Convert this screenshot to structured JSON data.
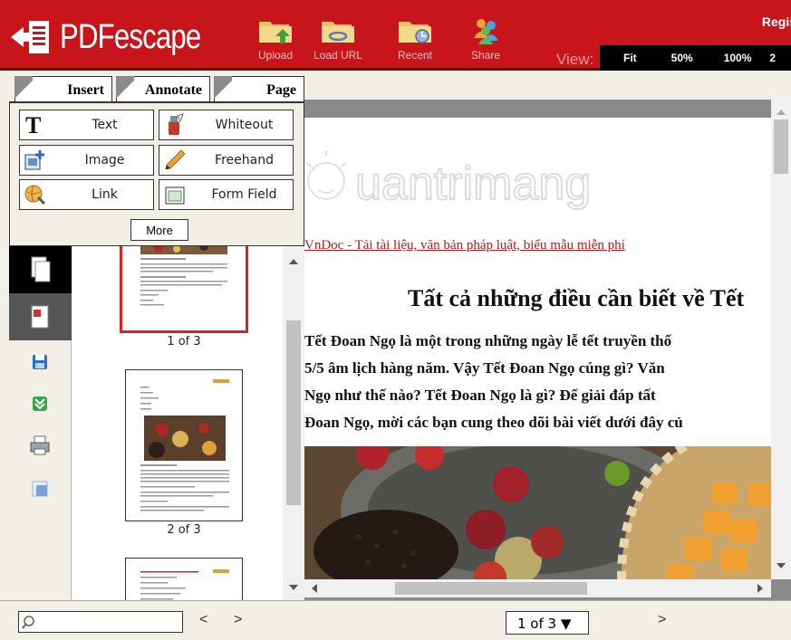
{
  "header": {
    "logo_text": "PDFescape",
    "register": "Regis",
    "view_label": "View:",
    "buttons": [
      {
        "label": "Upload",
        "icon": "folder-upload-icon"
      },
      {
        "label": "Load URL",
        "icon": "folder-link-icon"
      },
      {
        "label": "Recent",
        "icon": "folder-clock-icon"
      },
      {
        "label": "Share",
        "icon": "people-share-icon"
      }
    ],
    "view_options": [
      "Fit",
      "50%",
      "100%",
      "2"
    ]
  },
  "tabs": [
    "Insert",
    "Annotate",
    "Page"
  ],
  "tools": [
    {
      "label": "Text",
      "icon": "text-tool-icon"
    },
    {
      "label": "Whiteout",
      "icon": "whiteout-bottle-icon"
    },
    {
      "label": "Image",
      "icon": "insert-image-icon"
    },
    {
      "label": "Freehand",
      "icon": "pencil-icon"
    },
    {
      "label": "Link",
      "icon": "link-globe-icon"
    },
    {
      "label": "Form Field",
      "icon": "form-field-icon"
    }
  ],
  "more_label": "More",
  "sidebar_icons": [
    "pages-icon",
    "pdf-icon",
    "save-icon",
    "download-icon",
    "print-icon",
    "page-layout-icon"
  ],
  "thumbnails": [
    {
      "label": "1 of 3"
    },
    {
      "label": "2 of 3"
    },
    {
      "label": ""
    }
  ],
  "document": {
    "link_text": "VnDoc - Tải tài liệu, văn bản pháp luật, biểu mẫu miễn phí",
    "title": "Tất cả những điều cần biết về Tết",
    "lines": [
      "Tết Đoan Ngọ là một trong những ngày lễ tết truyền thố",
      "5/5 âm lịch hàng năm. Vậy Tết Đoan Ngọ cúng gì? Văn",
      "Ngọ như thế nào? Tết Đoan Ngọ là gì? Để giải đáp tất",
      "Đoan Ngọ, mời các bạn cung theo dõi bài viết dưới đây củ"
    ],
    "watermark_text": "uantrimang"
  },
  "bottom": {
    "search_placeholder": "",
    "prev": "<",
    "next": ">",
    "page_select": "1 of 3 ▼",
    "next_page": ">"
  }
}
